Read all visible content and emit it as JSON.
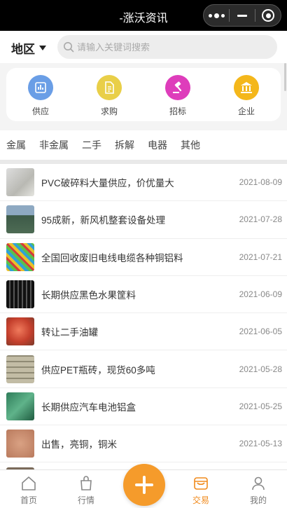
{
  "titlebar": {
    "title": "-涨沃资讯"
  },
  "search": {
    "region_label": "地区",
    "placeholder": "请输入关键词搜索"
  },
  "categories": [
    {
      "label": "供应",
      "icon": "chart-icon",
      "color": "#6a9ee6"
    },
    {
      "label": "求购",
      "icon": "document-icon",
      "color": "#e9cf48"
    },
    {
      "label": "招标",
      "icon": "gavel-icon",
      "color": "#de3dbb"
    },
    {
      "label": "企业",
      "icon": "bank-icon",
      "color": "#f4b71b"
    }
  ],
  "tabs": [
    "金属",
    "非金属",
    "二手",
    "拆解",
    "电器",
    "其他"
  ],
  "list": [
    {
      "title": "PVC破碎料大量供应，价优量大",
      "date": "2021-08-09",
      "thumb": "#c9c9c4"
    },
    {
      "title": "95成新，新风机整套设备处理",
      "date": "2021-07-28",
      "thumb": "#5d7790"
    },
    {
      "title": "全国回收废旧电线电缆各种铜铝料",
      "date": "2021-07-21",
      "thumb": "#4da4c6"
    },
    {
      "title": "长期供应黑色水果筐料",
      "date": "2021-06-09",
      "thumb": "#2d2d2d"
    },
    {
      "title": "转让二手油罐",
      "date": "2021-06-05",
      "thumb": "#d0533f"
    },
    {
      "title": "供应PET瓶砖，现货60多吨",
      "date": "2021-05-28",
      "thumb": "#b1ab96"
    },
    {
      "title": "长期供应汽车电池铝盒",
      "date": "2021-05-25",
      "thumb": "#3c8f67"
    },
    {
      "title": "出售，亮铜，铜米",
      "date": "2021-05-13",
      "thumb": "#c98b6e"
    },
    {
      "title": "",
      "date": "",
      "thumb": "#7a6a5a"
    }
  ],
  "tabbar": {
    "home": "首页",
    "market": "行情",
    "trade": "交易",
    "mine": "我的",
    "accent": "#f08a1c"
  }
}
